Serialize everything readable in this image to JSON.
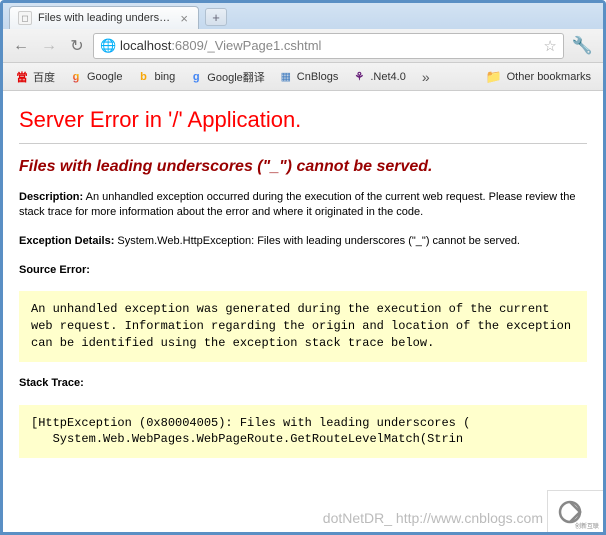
{
  "tab": {
    "title": "Files with leading underscores",
    "close": "×"
  },
  "nav": {
    "url_host": "localhost",
    "url_port": ":6809",
    "url_path": "/_ViewPage1.cshtml"
  },
  "bookmarks": {
    "items": [
      {
        "label": "百度"
      },
      {
        "label": "Google"
      },
      {
        "label": "bing"
      },
      {
        "label": "Google翻译"
      },
      {
        "label": "CnBlogs"
      },
      {
        "label": ".Net4.0"
      }
    ],
    "overflow": "»",
    "other": "Other bookmarks"
  },
  "error": {
    "title": "Server Error in '/' Application.",
    "subtitle": "Files with leading underscores (\"_\") cannot be served.",
    "description_label": "Description:",
    "description_text": " An unhandled exception occurred during the execution of the current web request. Please review the stack trace for more information about the error and where it originated in the code.",
    "exception_label": "Exception Details:",
    "exception_text": " System.Web.HttpException: Files with leading underscores (\"_\") cannot be served.",
    "source_error_label": "Source Error:",
    "source_error_box": "An unhandled exception was generated during the execution of the current web request. Information regarding the origin and location of the exception can be identified using the exception stack trace below.",
    "stack_trace_label": "Stack Trace:",
    "stack_trace_box": "[HttpException (0x80004005): Files with leading underscores (\n   System.Web.WebPages.WebPageRoute.GetRouteLevelMatch(Strin"
  },
  "watermark": "dotNetDR_ http://www.cnblogs.com",
  "corner": "创新互联"
}
